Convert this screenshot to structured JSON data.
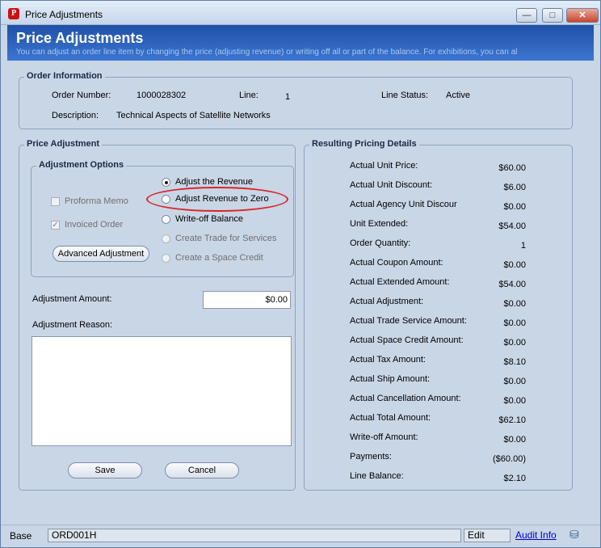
{
  "window": {
    "title": "Price Adjustments",
    "app_icon_letter": "P",
    "minimize": "—",
    "maximize": "□",
    "close": "✕"
  },
  "header": {
    "title": "Price Adjustments",
    "subtitle": "You can adjust an order line item by changing the price (adjusting revenue) or writing off all or part of the balance. For exhibitions, you can al"
  },
  "order_info": {
    "legend": "Order Information",
    "order_number_label": "Order Number:",
    "order_number": "1000028302",
    "line_label": "Line:",
    "line": "1",
    "line_status_label": "Line Status:",
    "line_status": "Active",
    "description_label": "Description:",
    "description": "Technical Aspects of Satellite Networks"
  },
  "price_adjustment": {
    "legend": "Price Adjustment",
    "options_legend": "Adjustment Options",
    "proforma_memo": "Proforma Memo",
    "invoiced_order": "Invoiced Order",
    "advanced_button": "Advanced Adjustment",
    "radios": [
      "Adjust the Revenue",
      "Adjust Revenue to Zero",
      "Write-off Balance",
      "Create Trade for Services",
      "Create a Space Credit"
    ],
    "amount_label": "Adjustment Amount:",
    "amount_value": "$0.00",
    "reason_label": "Adjustment Reason:",
    "reason_value": "",
    "save": "Save",
    "cancel": "Cancel"
  },
  "pricing_details": {
    "legend": "Resulting Pricing Details",
    "rows": [
      {
        "label": "Actual Unit Price:",
        "value": "$60.00"
      },
      {
        "label": "Actual Unit Discount:",
        "value": "$6.00"
      },
      {
        "label": "Actual Agency Unit Discour",
        "value": "$0.00"
      },
      {
        "label": "Unit Extended:",
        "value": "$54.00"
      },
      {
        "label": "Order Quantity:",
        "value": "1"
      },
      {
        "label": "Actual Coupon Amount:",
        "value": "$0.00"
      },
      {
        "label": "Actual Extended Amount:",
        "value": "$54.00"
      },
      {
        "label": "Actual Adjustment:",
        "value": "$0.00"
      },
      {
        "label": "Actual Trade Service Amount:",
        "value": "$0.00"
      },
      {
        "label": "Actual Space Credit Amount:",
        "value": "$0.00"
      },
      {
        "label": "Actual Tax Amount:",
        "value": "$8.10"
      },
      {
        "label": "Actual Ship Amount:",
        "value": "$0.00"
      },
      {
        "label": "Actual Cancellation Amount:",
        "value": "$0.00"
      },
      {
        "label": "Actual Total Amount:",
        "value": "$62.10"
      },
      {
        "label": "Write-off Amount:",
        "value": "$0.00"
      },
      {
        "label": "Payments:",
        "value": "($60.00)"
      },
      {
        "label": "Line Balance:",
        "value": "$2.10"
      }
    ]
  },
  "statusbar": {
    "base": "Base",
    "form": "ORD001H",
    "mode": "Edit",
    "audit_info": "Audit Info"
  }
}
